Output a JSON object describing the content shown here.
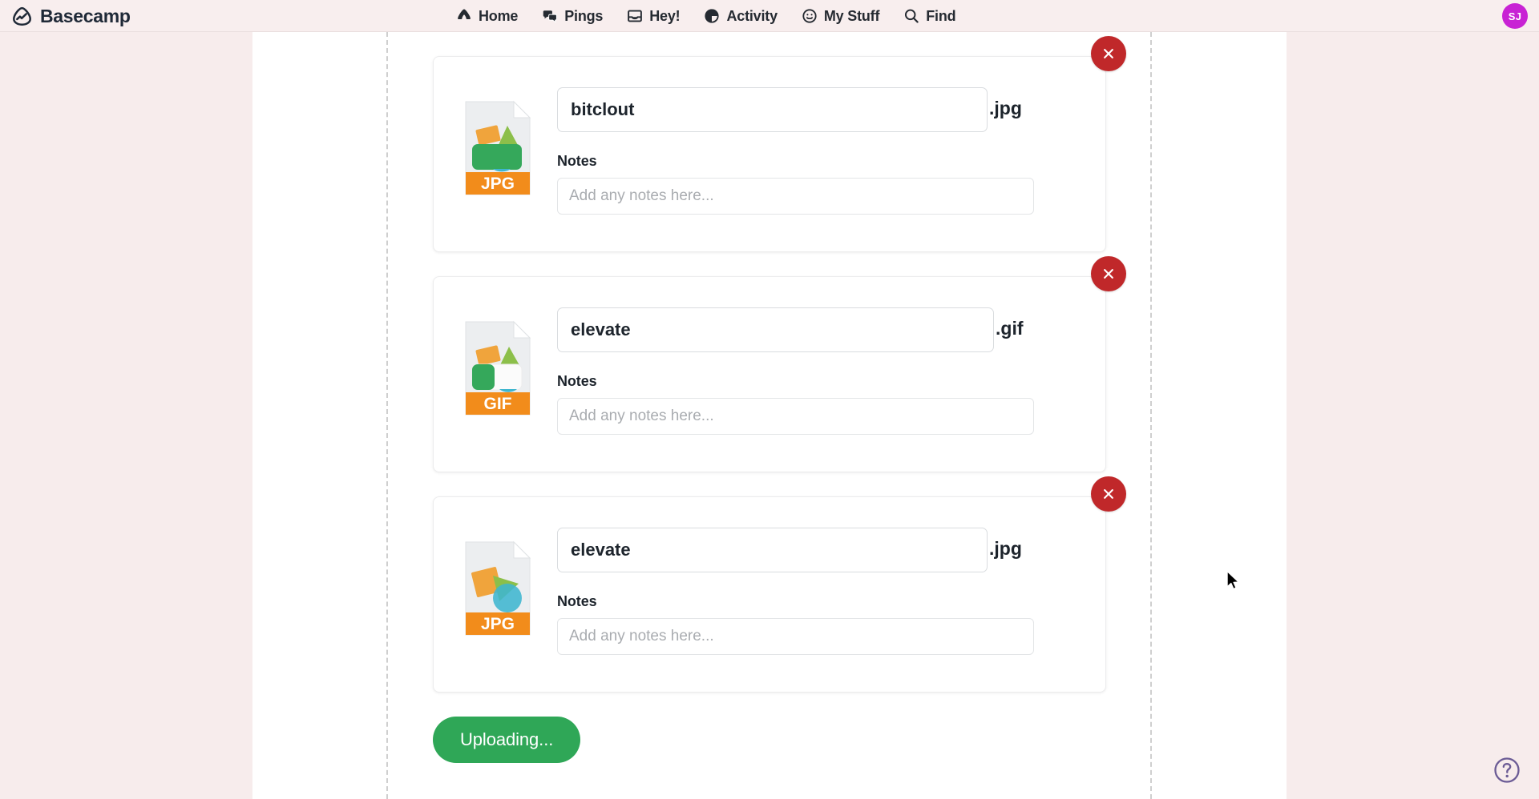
{
  "brand": {
    "name": "Basecamp",
    "logo_icon": "basecamp-hill-icon"
  },
  "nav": {
    "items": [
      {
        "label": "Home",
        "icon": "home-icon"
      },
      {
        "label": "Pings",
        "icon": "chat-bubbles-icon"
      },
      {
        "label": "Hey!",
        "icon": "inbox-tray-icon"
      },
      {
        "label": "Activity",
        "icon": "pie-clock-icon"
      },
      {
        "label": "My Stuff",
        "icon": "smiley-face-icon"
      },
      {
        "label": "Find",
        "icon": "search-icon"
      }
    ]
  },
  "account": {
    "avatar_initials": "SJ",
    "avatar_color": "#c822d4"
  },
  "upload": {
    "notes_label": "Notes",
    "notes_placeholder": "Add any notes here...",
    "remove_icon": "close-x-icon",
    "remove_color": "#c0282a",
    "submit_label": "Uploading...",
    "submit_color": "#2fa757",
    "files": [
      {
        "name": "bitclout",
        "extension": ".jpg",
        "type_label": "JPG",
        "icon": "jpg-file-icon",
        "notes": "",
        "art": "photo-tray"
      },
      {
        "name": "elevate",
        "extension": ".gif",
        "type_label": "GIF",
        "icon": "gif-file-icon",
        "notes": "",
        "art": "photo-card"
      },
      {
        "name": "elevate",
        "extension": ".jpg",
        "type_label": "JPG",
        "icon": "jpg-file-icon",
        "notes": "",
        "art": "shapes"
      }
    ]
  },
  "help": {
    "label": "?",
    "icon": "question-circle-icon",
    "color": "#6b5b95"
  },
  "colors": {
    "page_background": "#f7ecec",
    "panel_background": "#ffffff",
    "topbar_background": "#f8eeee",
    "dropzone_border": "#cfcfcf",
    "file_badge": "#f28c1b",
    "text_primary": "#1d242c",
    "placeholder": "#a9acb0"
  }
}
